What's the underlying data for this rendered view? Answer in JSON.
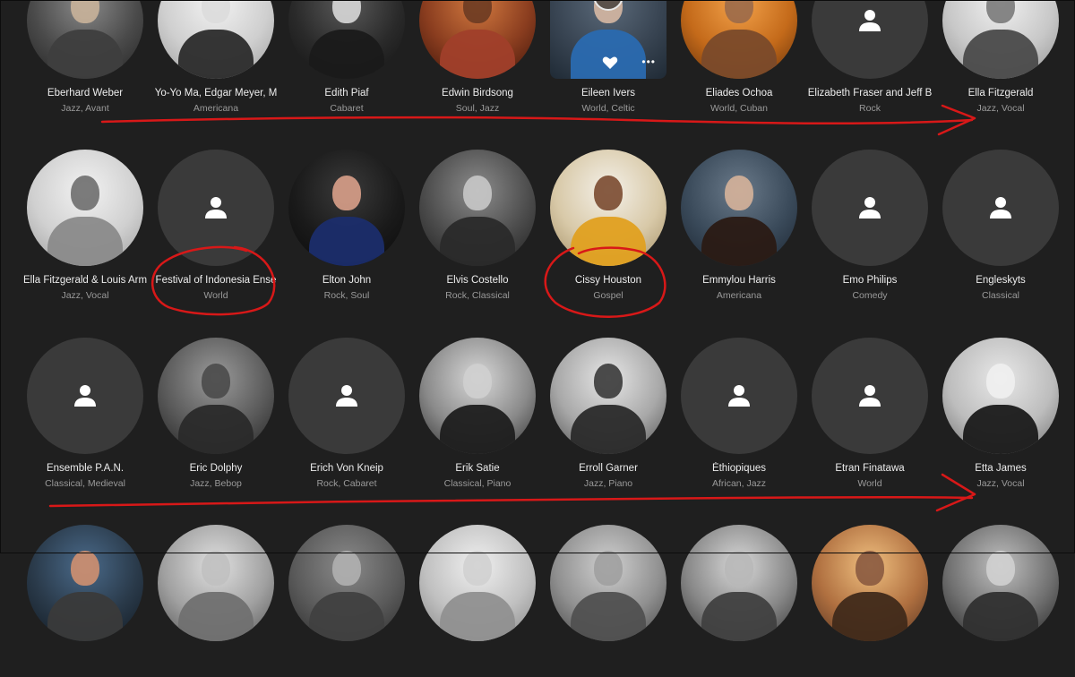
{
  "rows": [
    [
      {
        "name": "Eberhard Weber",
        "genres": "Jazz,  Avant",
        "img": "photo",
        "c1": "#8a8a8a",
        "c2": "#4a4a4a",
        "c3": "#222",
        "face": "#c9b39a",
        "cloth": "#3e3e3e"
      },
      {
        "name": "Yo-Yo Ma, Edgar Meyer, M",
        "genres": "Americana",
        "img": "photo",
        "c1": "#f2f2f2",
        "c2": "#cfcfcf",
        "c3": "#9a9a9a",
        "face": "#dcdcdc",
        "cloth": "#2b2b2b"
      },
      {
        "name": "Edith Piaf",
        "genres": "Cabaret",
        "img": "photo",
        "c1": "#5a5a5a",
        "c2": "#2a2a2a",
        "c3": "#111",
        "face": "#d8d8d8",
        "cloth": "#1a1a1a"
      },
      {
        "name": "Edwin Birdsong",
        "genres": "Soul,  Jazz",
        "img": "photo",
        "c1": "#d2793f",
        "c2": "#8a3d1f",
        "c3": "#3a1208",
        "face": "#6b3b22",
        "cloth": "#a03f2a"
      },
      {
        "name": "Eileen Ivers",
        "genres": "World,  Celtic",
        "img": "hover",
        "c1": "#5b6a7a",
        "c2": "#394553",
        "c3": "#1f2a35",
        "face": "#d6b8a3",
        "cloth": "#2a6ab0"
      },
      {
        "name": "Eliades Ochoa",
        "genres": "World,  Cuban",
        "img": "photo",
        "c1": "#f3a24a",
        "c2": "#c46a1a",
        "c3": "#5e2d0a",
        "face": "#9b6a4a",
        "cloth": "#7a4a2a"
      },
      {
        "name": "Elizabeth Fraser and Jeff B",
        "genres": "Rock",
        "img": "empty"
      },
      {
        "name": "Ella Fitzgerald",
        "genres": "Jazz,  Vocal",
        "img": "photo",
        "c1": "#f0f0f0",
        "c2": "#c8c8c8",
        "c3": "#8f8f8f",
        "face": "#7a7a7a",
        "cloth": "#4a4a4a"
      }
    ],
    [
      {
        "name": "Ella Fitzgerald & Louis Arm",
        "genres": "Jazz,  Vocal",
        "img": "photo",
        "c1": "#f2f2f2",
        "c2": "#d0d0d0",
        "c3": "#9a9a9a",
        "face": "#6e6e6e",
        "cloth": "#8a8a8a"
      },
      {
        "name": "Festival of Indonesia Ense",
        "genres": "World",
        "img": "empty"
      },
      {
        "name": "Elton John",
        "genres": "Rock,  Soul",
        "img": "photo",
        "c1": "#3a3a3a",
        "c2": "#1a1a1a",
        "c3": "#0a0a0a",
        "face": "#d9a08a",
        "cloth": "#1b2d6b"
      },
      {
        "name": "Elvis Costello",
        "genres": "Rock,  Classical",
        "img": "photo",
        "c1": "#8c8c8c",
        "c2": "#4c4c4c",
        "c3": "#1c1c1c",
        "face": "#c8c8c8",
        "cloth": "#2a2a2a"
      },
      {
        "name": "Cissy Houston",
        "genres": "Gospel",
        "img": "photo",
        "c1": "#f4f0e8",
        "c2": "#d8c9a8",
        "c3": "#a08a60",
        "face": "#7a4a30",
        "cloth": "#e0a020"
      },
      {
        "name": "Emmylou Harris",
        "genres": "Americana",
        "img": "photo",
        "c1": "#6a7a8a",
        "c2": "#3a4a5a",
        "c3": "#1a2430",
        "face": "#d6b39a",
        "cloth": "#2a1a14"
      },
      {
        "name": "Emo Philips",
        "genres": "Comedy",
        "img": "empty"
      },
      {
        "name": "Engleskyts",
        "genres": "Classical",
        "img": "empty"
      }
    ],
    [
      {
        "name": "Ensemble P.A.N.",
        "genres": "Classical,  Medieval",
        "img": "empty"
      },
      {
        "name": "Eric Dolphy",
        "genres": "Jazz,  Bebop",
        "img": "photo",
        "c1": "#9a9a9a",
        "c2": "#5a5a5a",
        "c3": "#202020",
        "face": "#4a4a4a",
        "cloth": "#2a2a2a"
      },
      {
        "name": "Erich Von Kneip",
        "genres": "Rock,  Cabaret",
        "img": "empty"
      },
      {
        "name": "Erik Satie",
        "genres": "Classical,  Piano",
        "img": "photo",
        "c1": "#d8d8d8",
        "c2": "#8a8a8a",
        "c3": "#2a2a2a",
        "face": "#cfcfcf",
        "cloth": "#1e1e1e"
      },
      {
        "name": "Erroll Garner",
        "genres": "Jazz,  Piano",
        "img": "photo",
        "c1": "#e6e6e6",
        "c2": "#a8a8a8",
        "c3": "#4a4a4a",
        "face": "#3a3a3a",
        "cloth": "#2a2a2a"
      },
      {
        "name": "Éthiopiques",
        "genres": "African,  Jazz",
        "img": "empty"
      },
      {
        "name": "Etran Finatawa",
        "genres": "World",
        "img": "empty"
      },
      {
        "name": "Etta James",
        "genres": "Jazz,  Vocal",
        "img": "photo",
        "c1": "#e8e8e8",
        "c2": "#bdbdbd",
        "c3": "#6a6a6a",
        "face": "#f0f0f0",
        "cloth": "#1a1a1a"
      }
    ],
    [
      {
        "name": "",
        "genres": "",
        "img": "photo",
        "c1": "#4a6a8a",
        "c2": "#2a3a4a",
        "c3": "#101820",
        "face": "#d09070",
        "cloth": "#3a3a3a"
      },
      {
        "name": "",
        "genres": "",
        "img": "photo",
        "c1": "#e0e0e0",
        "c2": "#a0a0a0",
        "c3": "#505050",
        "face": "#c0c0c0",
        "cloth": "#707070"
      },
      {
        "name": "",
        "genres": "",
        "img": "photo",
        "c1": "#8a8a8a",
        "c2": "#5a5a5a",
        "c3": "#2a2a2a",
        "face": "#b0b0b0",
        "cloth": "#404040"
      },
      {
        "name": "",
        "genres": "",
        "img": "photo",
        "c1": "#f0f0f0",
        "c2": "#c0c0c0",
        "c3": "#808080",
        "face": "#d0d0d0",
        "cloth": "#909090"
      },
      {
        "name": "",
        "genres": "",
        "img": "photo",
        "c1": "#d0d0d0",
        "c2": "#909090",
        "c3": "#404040",
        "face": "#a0a0a0",
        "cloth": "#505050"
      },
      {
        "name": "",
        "genres": "",
        "img": "photo",
        "c1": "#d8d8d8",
        "c2": "#888888",
        "c3": "#303030",
        "face": "#b8b8b8",
        "cloth": "#404040"
      },
      {
        "name": "",
        "genres": "",
        "img": "photo",
        "c1": "#f0c080",
        "c2": "#b07040",
        "c3": "#503020",
        "face": "#8a5a40",
        "cloth": "#402a1a"
      },
      {
        "name": "",
        "genres": "",
        "img": "photo",
        "c1": "#c0c0c0",
        "c2": "#707070",
        "c3": "#202020",
        "face": "#d0d0d0",
        "cloth": "#303030"
      }
    ]
  ],
  "colors": {
    "background": "#1f1f1f",
    "placeholder": "#3a3a3a",
    "name": "#ededed",
    "genre": "#9a9a9a",
    "annotation": "#d81818"
  }
}
